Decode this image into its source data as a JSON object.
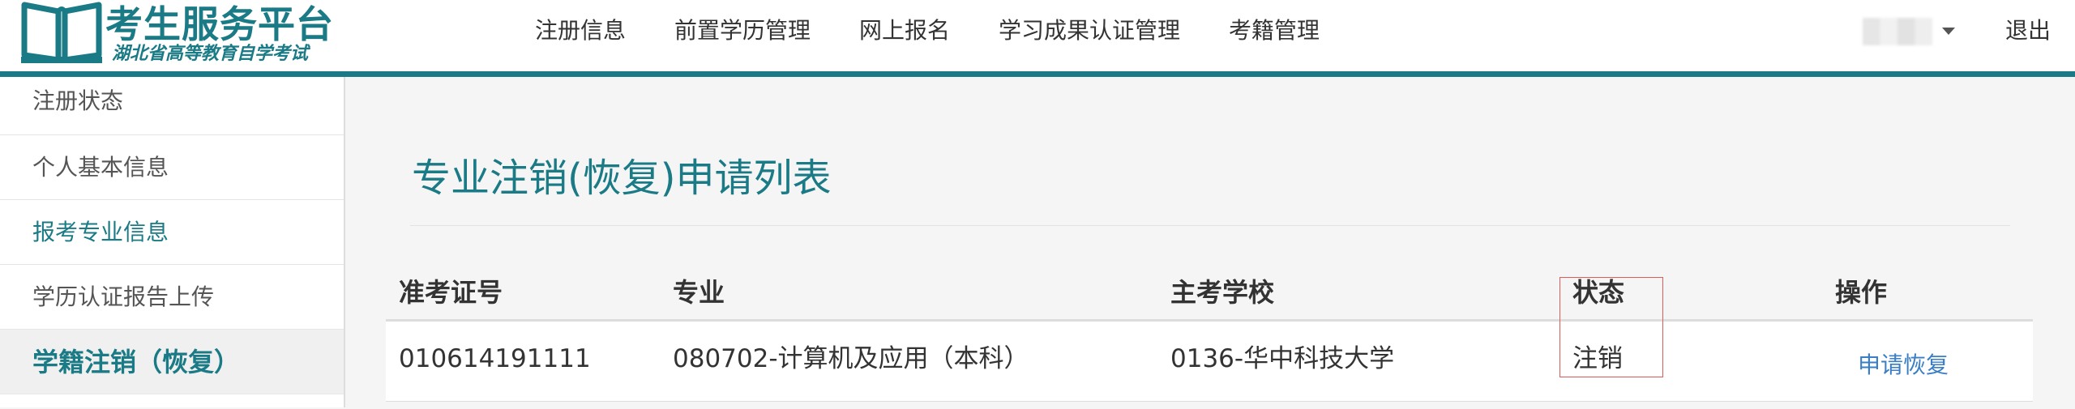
{
  "header": {
    "logo_title": "考生服务平台",
    "logo_subtitle": "湖北省高等教育自学考试",
    "nav": [
      "注册信息",
      "前置学历管理",
      "网上报名",
      "学习成果认证管理",
      "考籍管理"
    ],
    "logout": "退出",
    "accent_color": "#1a7a85"
  },
  "sidebar": {
    "items": [
      "注册状态",
      "个人基本信息",
      "报考专业信息",
      "学历认证报告上传",
      "学籍注销（恢复）"
    ]
  },
  "main": {
    "title": "专业注销(恢复)申请列表",
    "table": {
      "columns": [
        "准考证号",
        "专业",
        "主考学校",
        "状态",
        "操作"
      ],
      "rows": [
        {
          "exam_id": "010614191111",
          "major": "080702-计算机及应用（本科）",
          "school": "0136-华中科技大学",
          "status": "注销",
          "action": "申请恢复"
        }
      ]
    }
  },
  "icons": {
    "logo": "open-book-icon",
    "user_menu": "caret-down-icon"
  }
}
